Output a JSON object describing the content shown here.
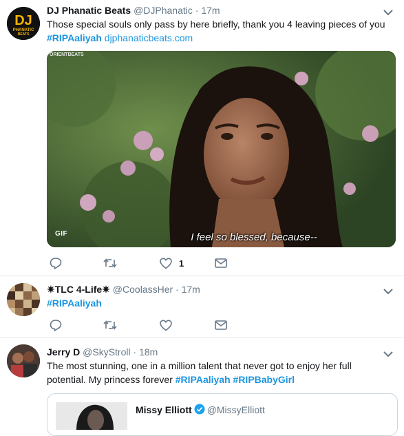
{
  "colors": {
    "accent": "#1b95e0",
    "text": "#14171a",
    "secondary": "#657786",
    "border": "#e6ecf0"
  },
  "tweets": [
    {
      "name": "DJ Phanatic Beats",
      "handle": "@DJPhanatic",
      "sep": " · ",
      "time": "17m",
      "avatar_text_1": "DJ",
      "avatar_text_2": "PHANATIC",
      "avatar_text_3": "BEATS",
      "text": "Those special souls only pass by here briefly, thank you 4 leaving pieces of you",
      "hashtag": "#RIPAaliyah",
      "link": "djphanaticbeats.com",
      "media": {
        "badge": "GIF",
        "caption": "I feel so blessed, because--",
        "watermark": "ORIENTBEATS"
      },
      "like_count": "1"
    },
    {
      "name": "✷TLC 4-Life✷",
      "handle": "@CoolassHer",
      "sep": " · ",
      "time": "17m",
      "hashtag": "#RIPAaliyah"
    },
    {
      "name": "Jerry D",
      "handle": "@SkyStroll",
      "sep": " · ",
      "time": "18m",
      "text_line1": "The most stunning, one in a million talent that never got to enjoy her full",
      "text_line2": "potential. My princess forever",
      "hashtag1": "#RIPAaliyah",
      "hashtag2": "#RIPBabyGirl",
      "quote": {
        "name": "Missy Elliott",
        "handle": "@MissyElliott"
      }
    }
  ],
  "icons": [
    "reply-icon",
    "retweet-icon",
    "like-icon",
    "message-icon",
    "caret-down-icon"
  ]
}
